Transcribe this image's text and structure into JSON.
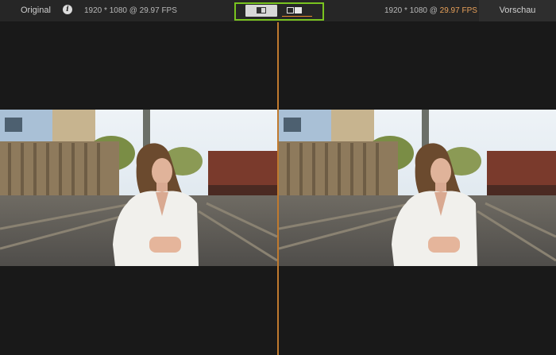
{
  "left_panel": {
    "label": "Original",
    "info_icon": "info-icon",
    "resolution_text": "1920 * 1080 @ 29.97 FPS"
  },
  "right_panel": {
    "label": "Vorschau",
    "resolution_prefix": "1920 * 1080 @ ",
    "fps_text": "29.97 FPS",
    "fps_color": "#e8a15a"
  },
  "view_modes": [
    {
      "icon": "split-view-icon",
      "active": true
    },
    {
      "icon": "side-by-side-view-icon",
      "active": false
    }
  ],
  "colors": {
    "highlight_border": "#79c31f",
    "divider": "#c07a2e",
    "background": "#1c1c1c"
  }
}
